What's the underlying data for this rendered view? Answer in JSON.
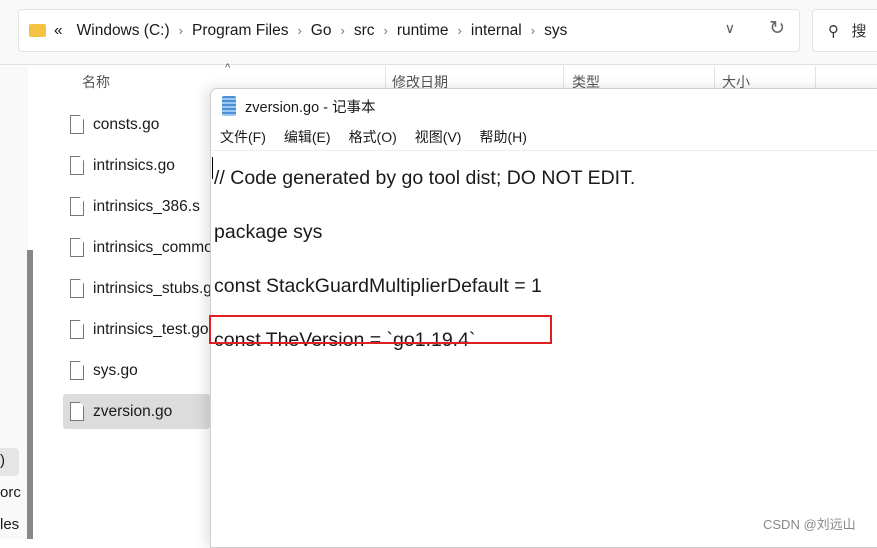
{
  "address": {
    "crumbs": [
      "Windows (C:)",
      "Program Files",
      "Go",
      "src",
      "runtime",
      "internal",
      "sys"
    ],
    "prefix": "«",
    "search_placeholder": "搜"
  },
  "nav": {
    "selected_text": ")",
    "items": [
      "orc",
      "les"
    ]
  },
  "columns": [
    "名称",
    "修改日期",
    "类型",
    "大小"
  ],
  "files": [
    "consts.go",
    "intrinsics.go",
    "intrinsics_386.s",
    "intrinsics_common.go",
    "intrinsics_stubs.go",
    "intrinsics_test.go",
    "sys.go",
    "zversion.go"
  ],
  "selected_file": "zversion.go",
  "notepad": {
    "title": "zversion.go - 记事本",
    "menu": [
      "文件(F)",
      "编辑(E)",
      "格式(O)",
      "视图(V)",
      "帮助(H)"
    ],
    "lines": [
      "// Code generated by go tool dist; DO NOT EDIT.",
      "package sys",
      "const StackGuardMultiplierDefault = 1",
      "const TheVersion = `go1.19.4`"
    ]
  },
  "highlight_color": "#e02020",
  "watermark": "CSDN @刘远山"
}
